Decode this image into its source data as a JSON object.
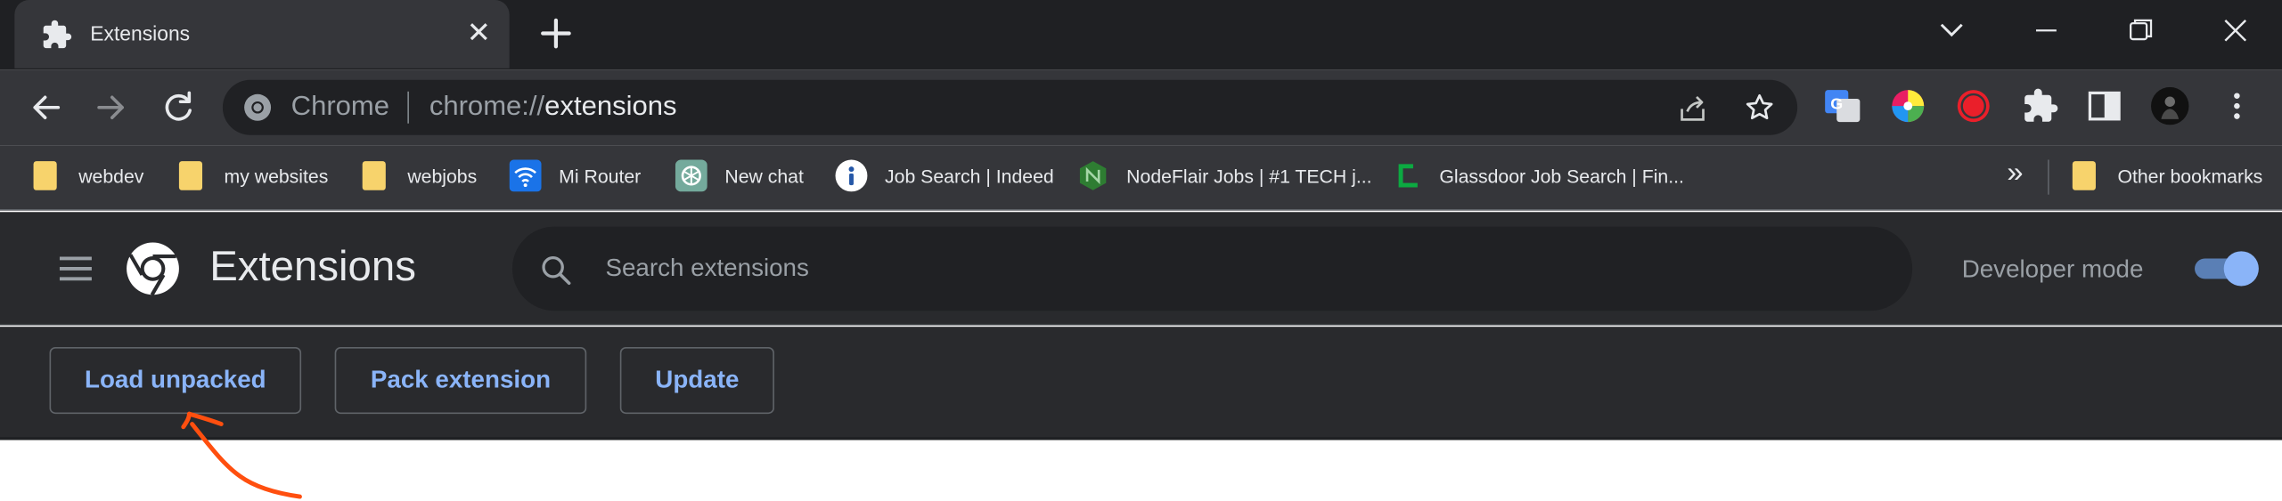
{
  "tab": {
    "title": "Extensions",
    "close_glyph": "✕"
  },
  "toolbar": {
    "omnibox": {
      "origin_label": "Chrome",
      "url_scheme": "chrome://",
      "url_host": "extensions"
    }
  },
  "bookmarks": [
    {
      "label": "webdev",
      "icon": "folder-icon"
    },
    {
      "label": "my websites",
      "icon": "folder-icon"
    },
    {
      "label": "webjobs",
      "icon": "folder-icon"
    },
    {
      "label": "Mi Router",
      "icon": "wifi-icon"
    },
    {
      "label": "New chat",
      "icon": "chatgpt-icon"
    },
    {
      "label": "Job Search | Indeed",
      "icon": "indeed-icon"
    },
    {
      "label": "NodeFlair Jobs | #1 TECH j...",
      "icon": "nodeflair-icon"
    },
    {
      "label": "Glassdoor Job Search | Fin...",
      "icon": "glassdoor-icon"
    }
  ],
  "bookmarks_overflow": "»",
  "other_bookmarks": "Other bookmarks",
  "header": {
    "title": "Extensions",
    "search_placeholder": "Search extensions",
    "developer_mode_label": "Developer mode",
    "developer_mode_on": true
  },
  "actions": {
    "load_unpacked": "Load unpacked",
    "pack_extension": "Pack extension",
    "update": "Update"
  },
  "colors": {
    "accent": "#8ab4f8",
    "annotation": "#ff4f0f",
    "page_bg": "#292a2d",
    "toolbar_bg": "#35363a"
  }
}
